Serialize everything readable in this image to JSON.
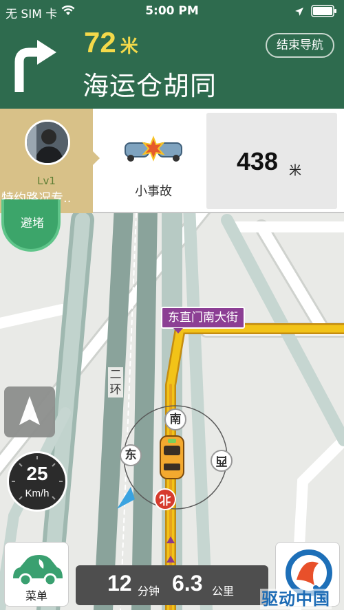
{
  "status_bar": {
    "carrier": "无 SIM 卡",
    "time": "5:00 PM"
  },
  "guidance": {
    "distance_value": "72",
    "distance_unit": "米",
    "next_street": "海运仓胡同",
    "end_nav_label": "结束导航"
  },
  "incident_panel": {
    "reporter_level": "Lv1",
    "reporter_name": "特约路况专..",
    "incident_type": "小事故",
    "incident_distance_value": "438",
    "incident_distance_unit": "米"
  },
  "avoid_congestion_label": "避堵",
  "map": {
    "current_road_label": "东直门南大街",
    "ring_road_label": "二环",
    "compass": {
      "south": "南",
      "east": "东",
      "west": "西",
      "north": "北"
    }
  },
  "speedometer": {
    "value": "25",
    "unit": "Km/h"
  },
  "bottom_bar": {
    "menu_label": "菜单",
    "time_value": "12",
    "time_unit": "分钟",
    "distance_value": "6.3",
    "distance_unit": "公里"
  },
  "watermark_text": "驱动中国",
  "colors": {
    "header_green": "#2e6b4e",
    "route_yellow": "#f2c318",
    "road_label_purple": "#8c3f94",
    "distance_yellow": "#f4d94a"
  }
}
